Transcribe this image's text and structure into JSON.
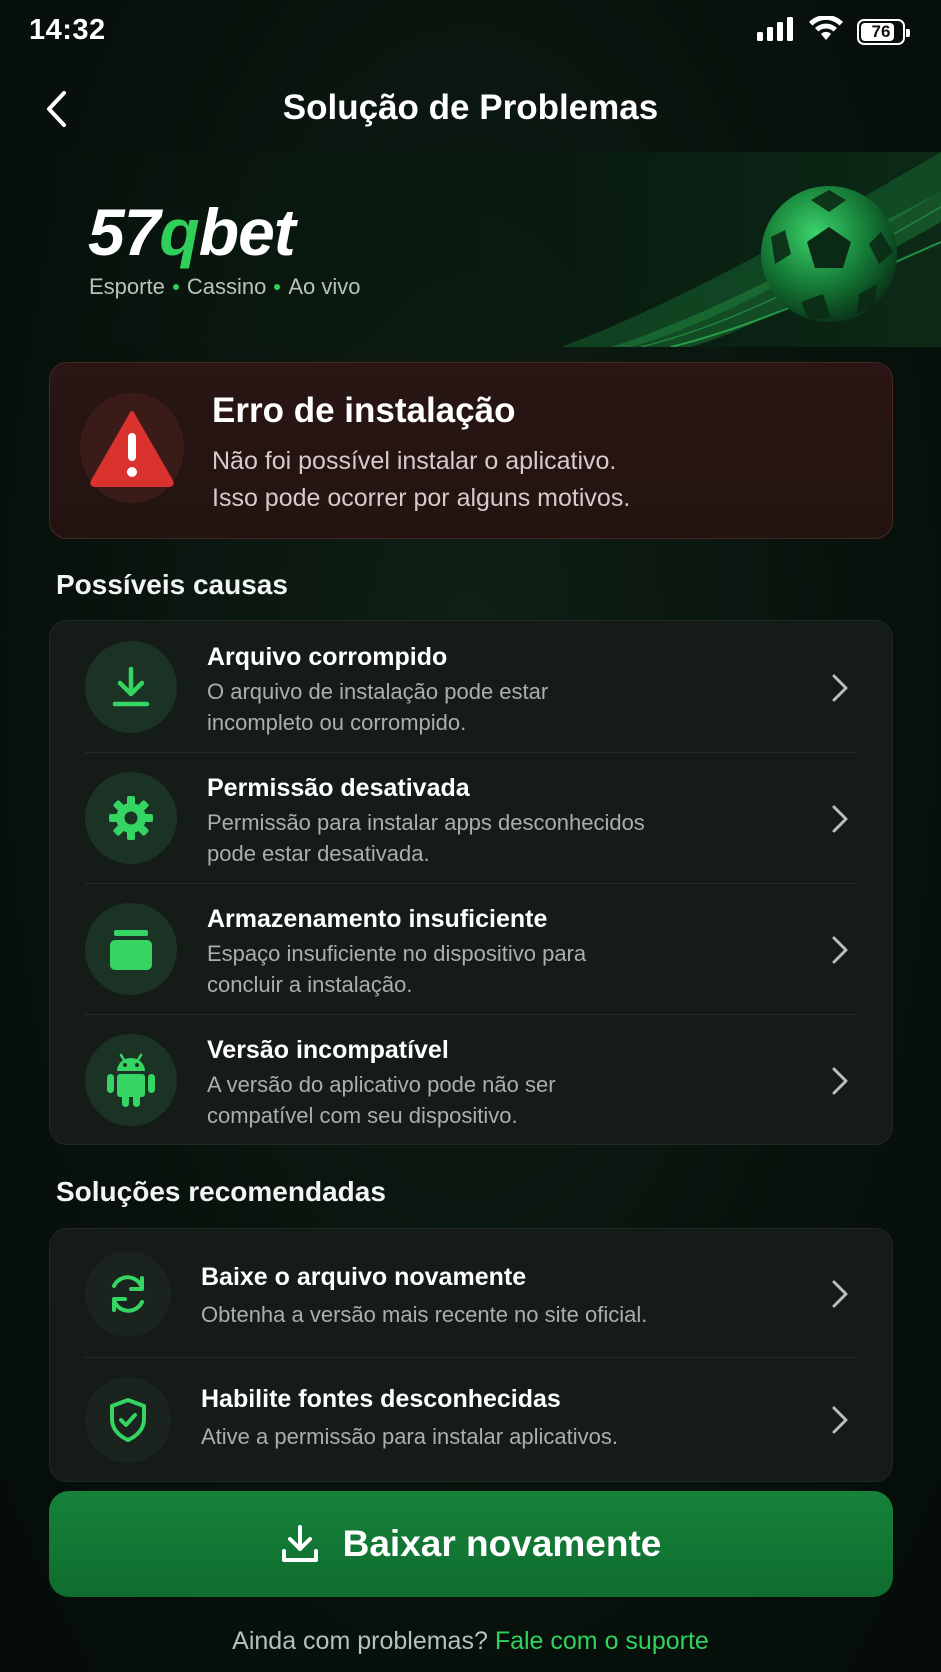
{
  "status_bar": {
    "time": "14:32",
    "battery": "76"
  },
  "header": {
    "title": "Solução de Problemas"
  },
  "banner": {
    "logo_part1": "57",
    "logo_part2": "q",
    "logo_part3": "bet",
    "tagline": [
      "Esporte",
      "Cassino",
      "Ao vivo"
    ]
  },
  "error": {
    "title": "Erro de instalação",
    "line1": "Não foi possível instalar o aplicativo.",
    "line2": "Isso pode ocorrer por alguns motivos."
  },
  "causes": {
    "section_title": "Possíveis causas",
    "items": [
      {
        "icon": "download-icon",
        "title": "Arquivo corrompido",
        "desc1": "O arquivo de instalação pode estar",
        "desc2": "incompleto ou corrompido."
      },
      {
        "icon": "gear-icon",
        "title": "Permissão desativada",
        "desc1": "Permissão para instalar apps desconhecidos",
        "desc2": "pode estar desativada."
      },
      {
        "icon": "storage-icon",
        "title": "Armazenamento insuficiente",
        "desc1": "Espaço insuficiente no dispositivo para",
        "desc2": "concluir a instalação."
      },
      {
        "icon": "android-icon",
        "title": "Versão incompatível",
        "desc1": "A versão do aplicativo pode não ser",
        "desc2": "compatível com seu dispositivo."
      }
    ]
  },
  "solutions": {
    "section_title": "Soluções recomendadas",
    "items": [
      {
        "icon": "refresh-icon",
        "title": "Baixe o arquivo novamente",
        "desc": "Obtenha a versão mais recente no site oficial."
      },
      {
        "icon": "shield-check-icon",
        "title": "Habilite fontes desconhecidas",
        "desc": "Ative a permissão para instalar aplicativos."
      }
    ]
  },
  "cta": {
    "label": "Baixar novamente"
  },
  "support": {
    "text": "Ainda com problemas?",
    "link": "Fale com o suporte"
  },
  "colors": {
    "accent": "#2fcf5a",
    "button": "#13783a",
    "error": "#d9322e"
  }
}
